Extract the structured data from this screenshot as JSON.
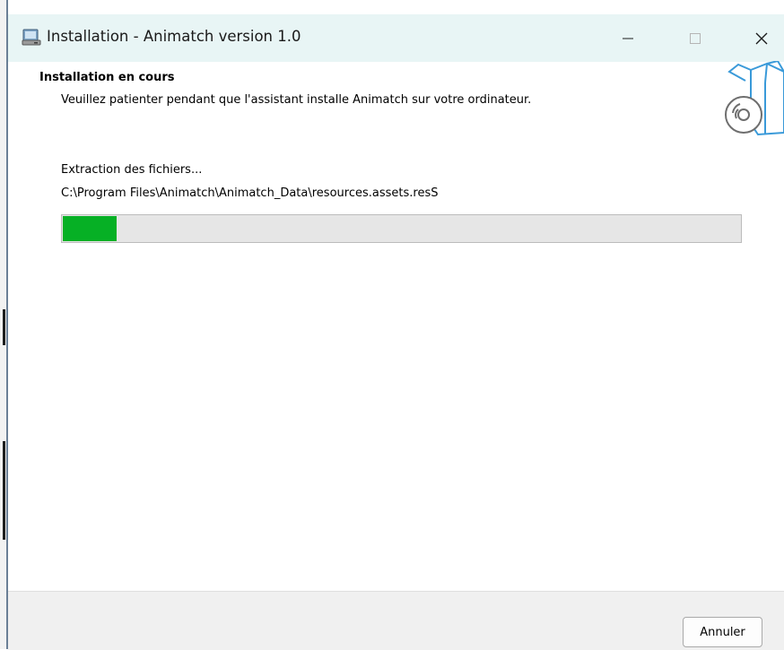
{
  "window": {
    "title": "Installation - Animatch version 1.0",
    "controls": {
      "minimize_glyph": "—",
      "maximize_glyph": "☐",
      "close_glyph": "✕"
    }
  },
  "header": {
    "title": "Installation en cours",
    "subtitle": "Veuillez patienter pendant que l'assistant installe Animatch sur votre ordinateur.",
    "icon": "software-box-cd-icon"
  },
  "progress": {
    "status": "Extraction des fichiers...",
    "current_file": "C:\\Program Files\\Animatch\\Animatch_Data\\resources.assets.resS",
    "fraction": 0.08,
    "color": "#06b025"
  },
  "footer": {
    "cancel_label": "Annuler"
  },
  "colors": {
    "titlebar_bg": "#e8f5f5",
    "footer_bg": "#f0f0f0",
    "track_bg": "#e6e6e6"
  }
}
